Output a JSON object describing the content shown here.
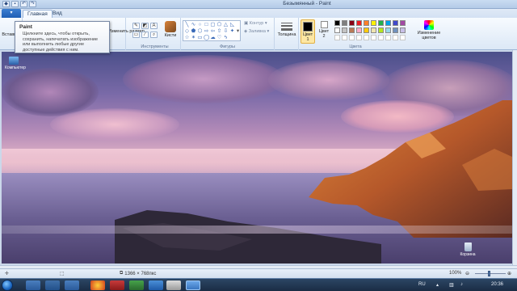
{
  "window": {
    "title": "Безымянный - Paint"
  },
  "tabs": {
    "file_label": "",
    "items": [
      "Главная",
      "Вид"
    ]
  },
  "ribbon": {
    "clipboard_label": "Вставить",
    "image_resize": "Изменить размер",
    "groups": {
      "tools": "Инструменты",
      "shapes": "Фигуры",
      "colors": "Цвета"
    },
    "brushes_label": "Кисти",
    "shape_options": {
      "outline": "Контур",
      "fill": "Заливка"
    },
    "thickness_label": "Толщина",
    "color1_label": "Цвет 1",
    "color2_label": "Цвет 2",
    "edit_colors_label": "Изменение цветов",
    "palette": [
      "#000000",
      "#7f7f7f",
      "#880015",
      "#ed1c24",
      "#ff7f27",
      "#fff200",
      "#22b14c",
      "#00a2e8",
      "#3f48cc",
      "#a349a4",
      "#ffffff",
      "#c3c3c3",
      "#b97a57",
      "#ffaec9",
      "#ffc90e",
      "#efe4b0",
      "#b5e61d",
      "#99d9ea",
      "#7092be",
      "#c8bfe7"
    ],
    "color1": "#000000",
    "color2": "#ffffff"
  },
  "tooltip": {
    "title": "Paint",
    "body": "Щелкните здесь, чтобы открыть, сохранить, напечатать изображение или выполнить любые другие доступные действия с ним."
  },
  "desktop": {
    "computer_icon": "Компьютер",
    "recycle_icon": "Корзина"
  },
  "status": {
    "size": "1366 × 768пкс",
    "zoom": "100%"
  },
  "taskbar": {
    "lang": "RU",
    "time": "20:36"
  }
}
